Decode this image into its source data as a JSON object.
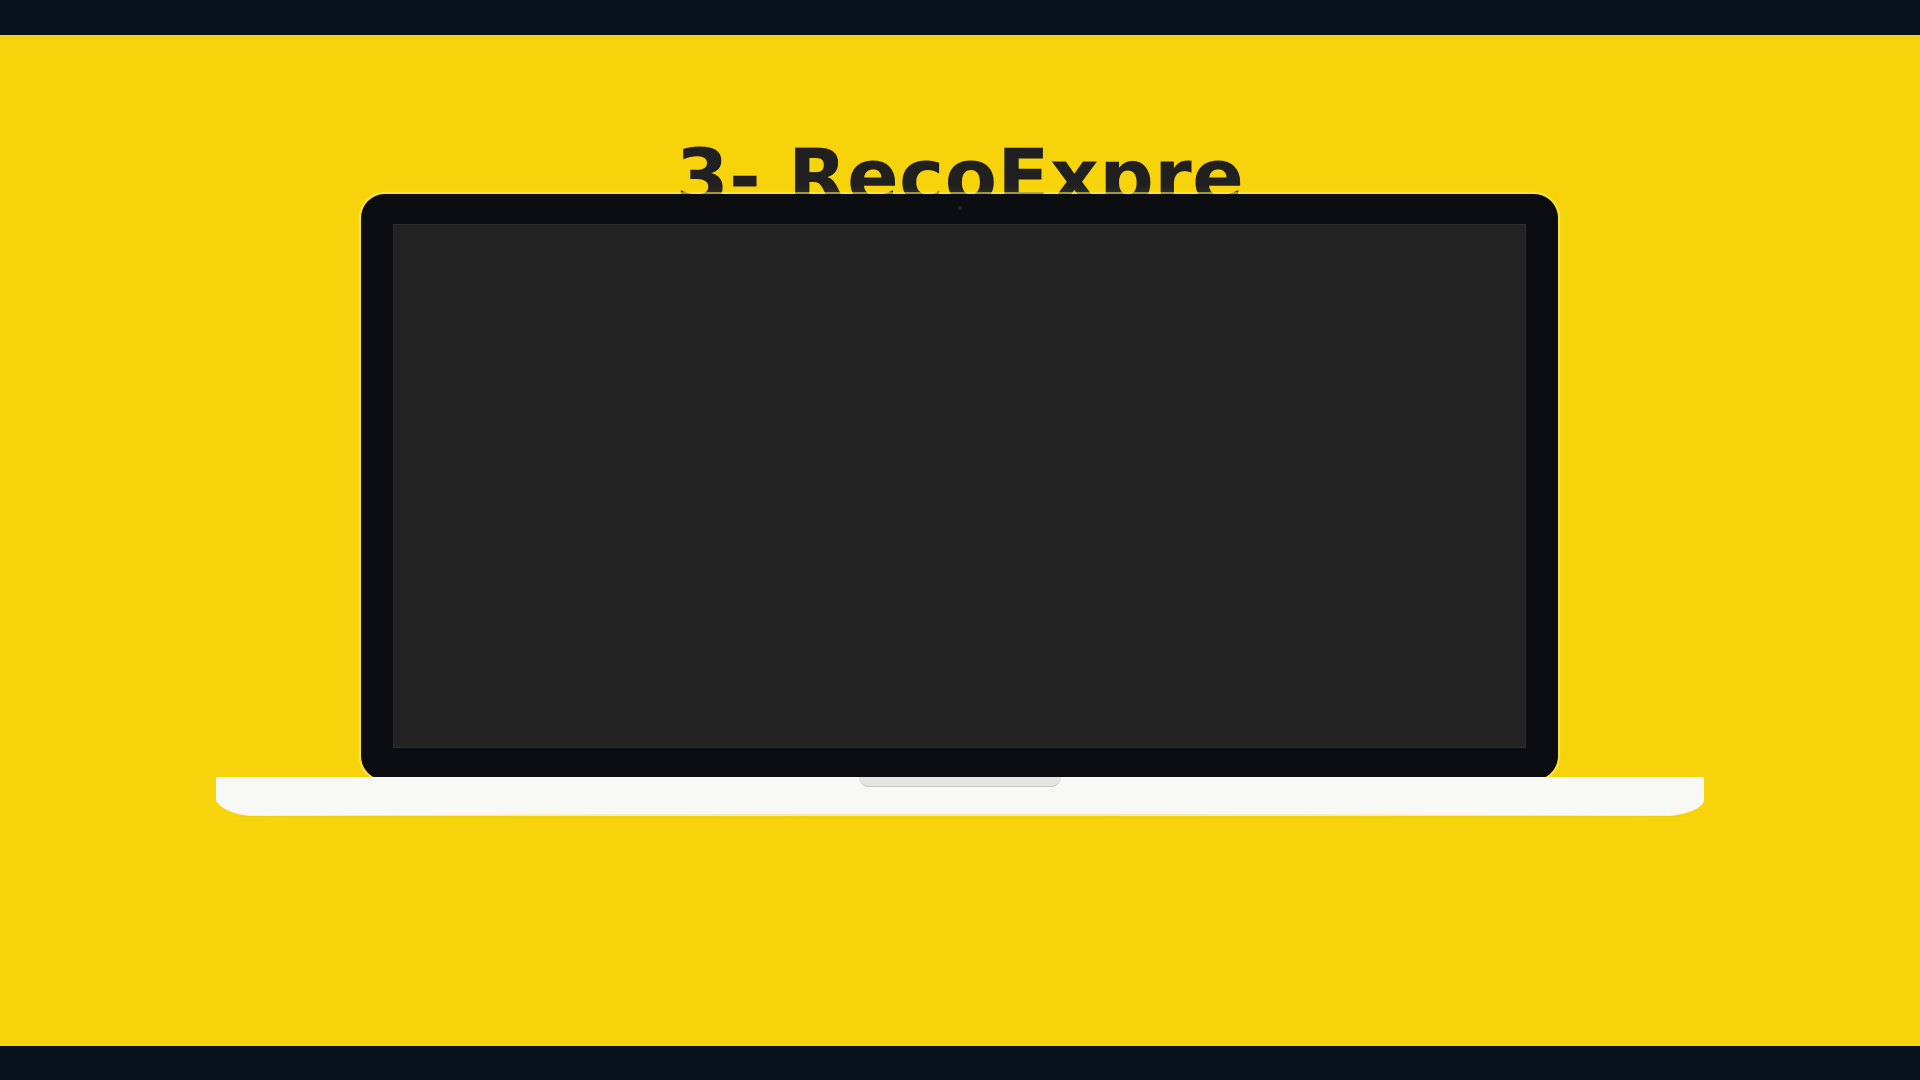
{
  "page": {
    "title": "3- RecoExpre"
  },
  "colors": {
    "background": "#f6d30a",
    "letterbox": "#07121d",
    "title": "#202020",
    "laptop_bezel": "#0b0d10",
    "laptop_screen": "#232323",
    "laptop_base": "#f8f8f4"
  }
}
